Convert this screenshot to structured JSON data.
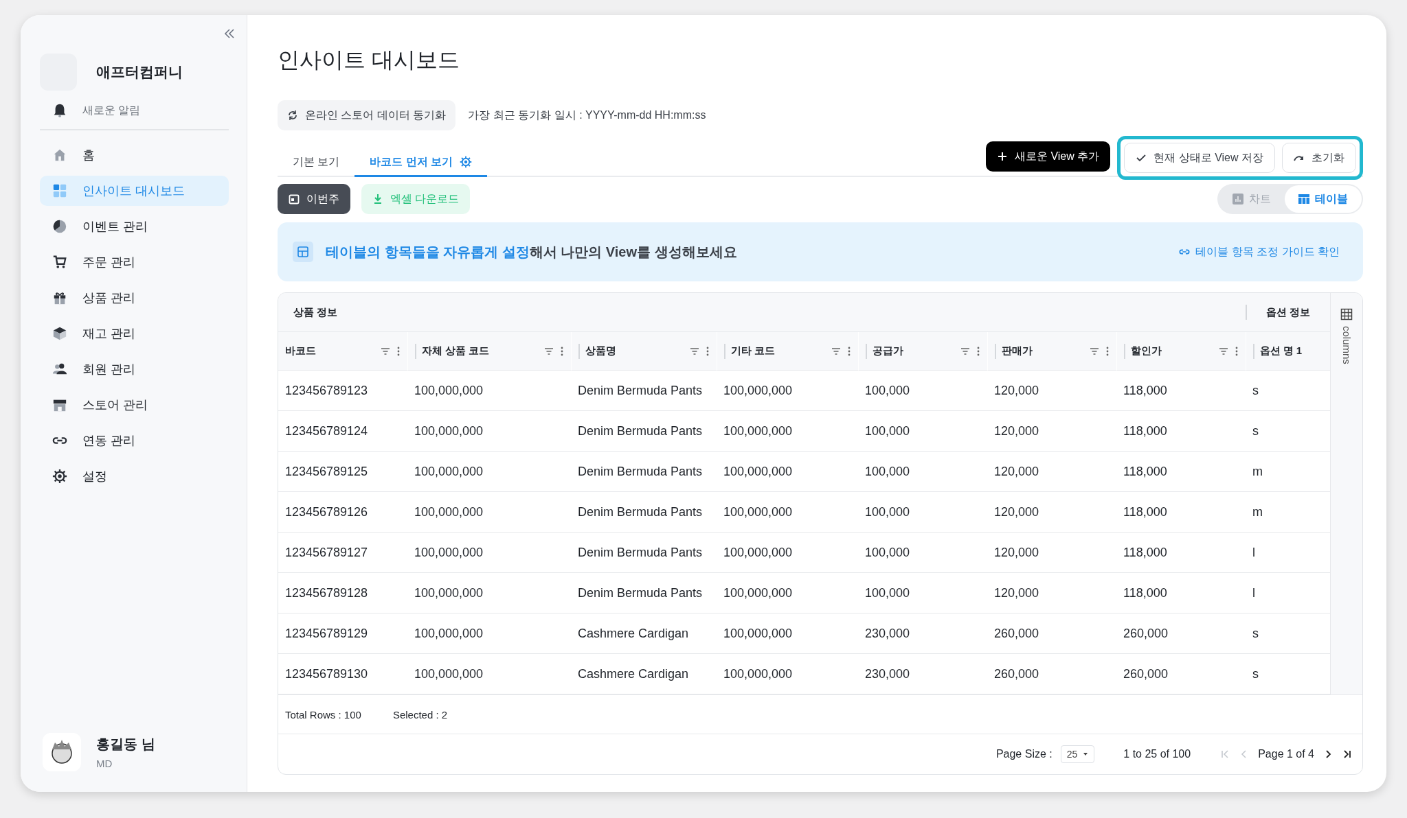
{
  "sidebar": {
    "company": "애프터컴퍼니",
    "notification": "새로운 알림",
    "items": [
      {
        "label": "홈",
        "selected": false
      },
      {
        "label": "인사이트 대시보드",
        "selected": true
      },
      {
        "label": "이벤트 관리",
        "selected": false
      },
      {
        "label": "주문 관리",
        "selected": false
      },
      {
        "label": "상품 관리",
        "selected": false
      },
      {
        "label": "재고 관리",
        "selected": false
      },
      {
        "label": "회원 관리",
        "selected": false
      },
      {
        "label": "스토어 관리",
        "selected": false
      },
      {
        "label": "연동 관리",
        "selected": false
      },
      {
        "label": "설정",
        "selected": false
      }
    ],
    "user": {
      "name": "홍길동 님",
      "role": "MD"
    }
  },
  "page": {
    "title": "인사이트 대시보드",
    "sync_button": "온라인 스토어 데이터 동기화",
    "last_sync": "가장 최근 동기화 일시 : YYYY-mm-dd HH:mm:ss"
  },
  "tabs": [
    {
      "label": "기본 보기",
      "selected": false
    },
    {
      "label": "바코드 먼저 보기",
      "selected": true
    }
  ],
  "actions": {
    "add_view": "새로운 View 추가",
    "save_view": "현재 상태로 View 저장",
    "reset": "초기화"
  },
  "filters": {
    "period": "이번주",
    "excel": "엑셀 다운로드"
  },
  "view_toggle": [
    {
      "label": "차트",
      "selected": false
    },
    {
      "label": "테이블",
      "selected": true
    }
  ],
  "banner": {
    "text": "**테이블의 항목들을 자유롭게 설정**해서 나만의 View를 생성해보세요",
    "link": "테이블 항목 조정 가이드 확인"
  },
  "table": {
    "groups": [
      "상품 정보",
      "옵션 정보"
    ],
    "side_panel": "columns",
    "columns": [
      "바코드",
      "자체 상품 코드",
      "상품명",
      "기타 코드",
      "공급가",
      "판매가",
      "할인가",
      "옵션 명 1"
    ],
    "rows": [
      [
        "123456789123",
        "100,000,000",
        "Denim Bermuda Pants",
        "100,000,000",
        "100,000",
        "120,000",
        "118,000",
        "s"
      ],
      [
        "123456789124",
        "100,000,000",
        "Denim Bermuda Pants",
        "100,000,000",
        "100,000",
        "120,000",
        "118,000",
        "s"
      ],
      [
        "123456789125",
        "100,000,000",
        "Denim Bermuda Pants",
        "100,000,000",
        "100,000",
        "120,000",
        "118,000",
        "m"
      ],
      [
        "123456789126",
        "100,000,000",
        "Denim Bermuda Pants",
        "100,000,000",
        "100,000",
        "120,000",
        "118,000",
        "m"
      ],
      [
        "123456789127",
        "100,000,000",
        "Denim Bermuda Pants",
        "100,000,000",
        "100,000",
        "120,000",
        "118,000",
        "l"
      ],
      [
        "123456789128",
        "100,000,000",
        "Denim Bermuda Pants",
        "100,000,000",
        "100,000",
        "120,000",
        "118,000",
        "l"
      ],
      [
        "123456789129",
        "100,000,000",
        "Cashmere Cardigan",
        "100,000,000",
        "230,000",
        "260,000",
        "260,000",
        "s"
      ],
      [
        "123456789130",
        "100,000,000",
        "Cashmere Cardigan",
        "100,000,000",
        "230,000",
        "260,000",
        "260,000",
        "s"
      ]
    ],
    "total_rows": "Total Rows : 100",
    "selected_count": "Selected : 2",
    "page_size_label": "Page Size :",
    "page_size": "25",
    "range": "1 to 25 of 100",
    "page": "Page 1 of 4"
  }
}
